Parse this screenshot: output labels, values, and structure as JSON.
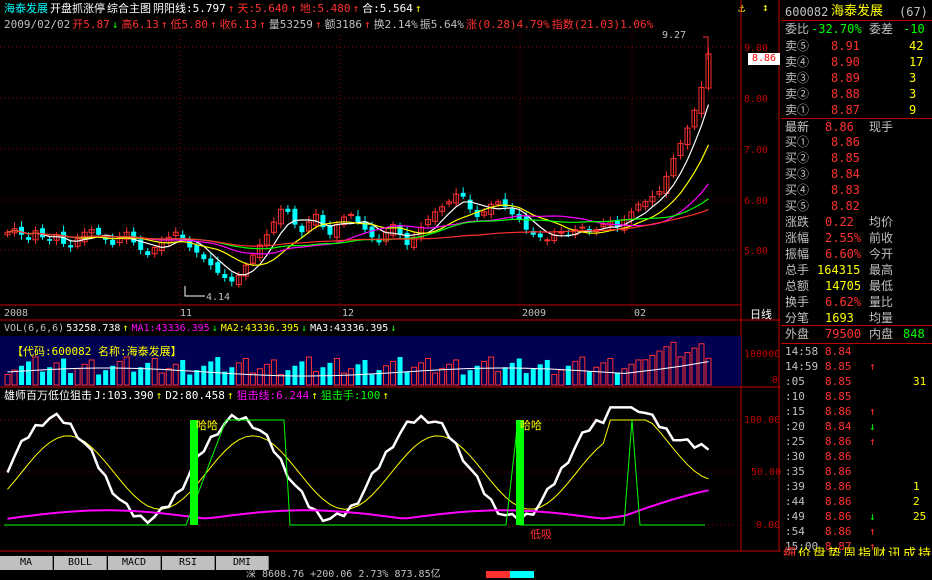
{
  "stock": {
    "code": "600082",
    "name": "海泰发展",
    "suffix": "(67)"
  },
  "main_header": {
    "line1": [
      {
        "text": "海泰发展",
        "color": "#00ffff"
      },
      {
        "text": "开盘抓涨停",
        "color": "#ffffff"
      },
      {
        "text": "综合主图",
        "color": "#ffffff"
      },
      {
        "text": "阴阳线:5.797",
        "color": "#ffffff"
      },
      {
        "text": "↑",
        "color": "#ff3030"
      },
      {
        "text": "天:5.640",
        "color": "#ff3030"
      },
      {
        "text": "↑",
        "color": "#ff3030"
      },
      {
        "text": "地:5.480",
        "color": "#ff3030"
      },
      {
        "text": "↑",
        "color": "#ff3030"
      },
      {
        "text": "合:5.564",
        "color": "#ffffff"
      },
      {
        "text": "↑",
        "color": "#ffff00"
      }
    ],
    "line2": [
      {
        "text": "2009/02/02",
        "color": "#c0c0c0"
      },
      {
        "text": "开5.87",
        "color": "#ff3030"
      },
      {
        "text": "↓",
        "color": "#00ff00"
      },
      {
        "text": "高6.13",
        "color": "#ff3030"
      },
      {
        "text": "↑",
        "color": "#ff3030"
      },
      {
        "text": "低5.80",
        "color": "#ff3030"
      },
      {
        "text": "↑",
        "color": "#ff3030"
      },
      {
        "text": "收6.13",
        "color": "#ff3030"
      },
      {
        "text": "↑",
        "color": "#ff3030"
      },
      {
        "text": "量53259",
        "color": "#c0c0c0"
      },
      {
        "text": "↑",
        "color": "#ff3030"
      },
      {
        "text": "额3186",
        "color": "#c0c0c0"
      },
      {
        "text": "↑",
        "color": "#ff3030"
      },
      {
        "text": "换2.14%",
        "color": "#c0c0c0"
      },
      {
        "text": "振5.64%",
        "color": "#c0c0c0"
      },
      {
        "text": "涨(0.28)4.79%",
        "color": "#ff3030"
      },
      {
        "text": "指数(21.03)1.06%",
        "color": "#ff3030"
      }
    ]
  },
  "price_axis": {
    "ticks": [
      "9.00",
      "8.00",
      "7.00",
      "6.00",
      "5.00"
    ],
    "current": "8.86",
    "top": "9.27",
    "low": "4.14"
  },
  "date_axis": {
    "labels": [
      "2008",
      "11",
      "12",
      "2009",
      "02"
    ],
    "period": "日线"
  },
  "volume_panel": {
    "header": [
      {
        "text": "VOL(6,6,6)",
        "color": "#c0c0c0"
      },
      {
        "text": "53258.738",
        "color": "#ffffff"
      },
      {
        "text": "↑",
        "color": "#ffff00"
      },
      {
        "text": "MA1:43336.395",
        "color": "#ff00ff"
      },
      {
        "text": "↓",
        "color": "#00ff00"
      },
      {
        "text": "MA2:43336.395",
        "color": "#ffff00"
      },
      {
        "text": "↓",
        "color": "#00ff00"
      },
      {
        "text": "MA3:43336.395",
        "color": "#ffffff"
      },
      {
        "text": "↓",
        "color": "#00ff00"
      }
    ],
    "banner": "【代码:600082 名称:海泰发展】",
    "axis": [
      "100000",
      "0"
    ]
  },
  "osc_panel": {
    "header": [
      {
        "text": "雄师百万低位狙击",
        "color": "#ffffff"
      },
      {
        "text": "J:103.390",
        "color": "#ffffff"
      },
      {
        "text": "↑",
        "color": "#ffff00"
      },
      {
        "text": "D2:80.458",
        "color": "#ffffff"
      },
      {
        "text": "↑",
        "color": "#ffff00"
      },
      {
        "text": "狙击线:6.244",
        "color": "#ff00ff"
      },
      {
        "text": "↑",
        "color": "#ffff00"
      },
      {
        "text": "狙击手:100",
        "color": "#00ff00"
      },
      {
        "text": "↑",
        "color": "#ffff00"
      }
    ],
    "axis": [
      "100.00",
      "50.00",
      "0.00"
    ],
    "labels": {
      "signal": "哈哈",
      "low": "低吸"
    }
  },
  "quote": {
    "weibi_label": "委比",
    "weibi_val": "-32.70%",
    "weicha_label": "委差",
    "weicha_val": "-10",
    "asks": [
      {
        "label": "卖⑤",
        "price": "8.91",
        "vol": "42"
      },
      {
        "label": "卖④",
        "price": "8.90",
        "vol": "17"
      },
      {
        "label": "卖③",
        "price": "8.89",
        "vol": "3"
      },
      {
        "label": "卖②",
        "price": "8.88",
        "vol": "3"
      },
      {
        "label": "卖①",
        "price": "8.87",
        "vol": "9"
      }
    ],
    "last_label": "最新",
    "last": "8.86",
    "xianshou_label": "现手",
    "xianshou": "",
    "bids": [
      {
        "label": "买①",
        "price": "8.86",
        "vol": ""
      },
      {
        "label": "买②",
        "price": "8.85",
        "vol": ""
      },
      {
        "label": "买③",
        "price": "8.84",
        "vol": ""
      },
      {
        "label": "买④",
        "price": "8.83",
        "vol": ""
      },
      {
        "label": "买⑤",
        "price": "8.82",
        "vol": ""
      }
    ],
    "stats": [
      {
        "l1": "涨跌",
        "v1": "0.22",
        "l2": "均价",
        "v2": ""
      },
      {
        "l1": "涨幅",
        "v1": "2.55%",
        "l2": "前收",
        "v2": ""
      },
      {
        "l1": "振幅",
        "v1": "6.60%",
        "l2": "今开",
        "v2": ""
      },
      {
        "l1": "总手",
        "v1": "164315",
        "l2": "最高",
        "v2": ""
      },
      {
        "l1": "总额",
        "v1": "14705",
        "l2": "最低",
        "v2": ""
      },
      {
        "l1": "换手",
        "v1": "6.62%",
        "l2": "量比",
        "v2": ""
      },
      {
        "l1": "分笔",
        "v1": "1693",
        "l2": "均量",
        "v2": ""
      }
    ],
    "outer_label": "外盘",
    "outer": "79500",
    "inner_label": "内盘",
    "inner": "848"
  },
  "ticks": [
    {
      "t": "14:58",
      "p": "8.84",
      "a": "",
      "v": "",
      "pc": "#ff3030"
    },
    {
      "t": "14:59",
      "p": "8.85",
      "a": "↑",
      "v": "",
      "pc": "#ff3030"
    },
    {
      "t": ":05",
      "p": "8.85",
      "a": "",
      "v": "31",
      "pc": "#ff3030"
    },
    {
      "t": ":10",
      "p": "8.85",
      "a": "",
      "v": "",
      "pc": "#ff3030"
    },
    {
      "t": ":15",
      "p": "8.86",
      "a": "↑",
      "v": "",
      "pc": "#ff3030"
    },
    {
      "t": ":20",
      "p": "8.84",
      "a": "↓",
      "v": "",
      "pc": "#ff3030"
    },
    {
      "t": ":25",
      "p": "8.86",
      "a": "↑",
      "v": "",
      "pc": "#ff3030"
    },
    {
      "t": ":30",
      "p": "8.86",
      "a": "",
      "v": "",
      "pc": "#ff3030"
    },
    {
      "t": ":35",
      "p": "8.86",
      "a": "",
      "v": "",
      "pc": "#ff3030"
    },
    {
      "t": ":39",
      "p": "8.86",
      "a": "",
      "v": "1",
      "pc": "#ff3030"
    },
    {
      "t": ":44",
      "p": "8.86",
      "a": "",
      "v": "2",
      "pc": "#ff3030"
    },
    {
      "t": ":49",
      "p": "8.86",
      "a": "↓",
      "v": "25",
      "pc": "#ff3030"
    },
    {
      "t": ":54",
      "p": "8.86",
      "a": "↑",
      "v": "",
      "pc": "#ff3030"
    },
    {
      "t": "15:00",
      "p": "8.87",
      "a": "↑",
      "v": "",
      "pc": "#ff3030"
    }
  ],
  "bottom_tabs": [
    "MA",
    "BOLL",
    "MACD",
    "RSI",
    "DMI"
  ],
  "sidebar_tabs": [
    "细",
    "价",
    "盘",
    "势",
    "周",
    "指",
    "财",
    "讯",
    "成",
    "持"
  ],
  "status": {
    "index_text": "深 8608.76 +200.06 2.73% 873.85亿"
  },
  "colors": {
    "up": "#ff3030",
    "down": "#00ffff",
    "grid": "#8b0000",
    "axis": "#c00000"
  }
}
